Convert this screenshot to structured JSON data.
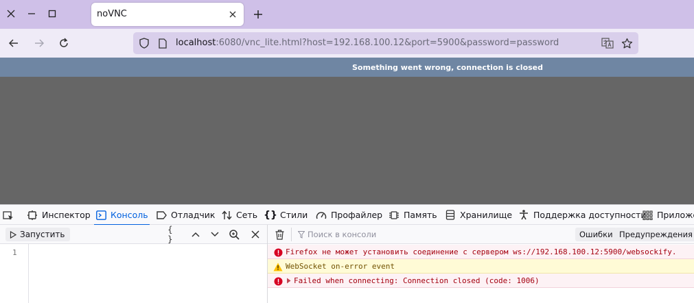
{
  "tab": {
    "title": "noVNC"
  },
  "url": {
    "host": "localhost",
    "rest": ":6080/vnc_lite.html?host=192.168.100.12&port=5900&password=password"
  },
  "vnc": {
    "status": "Something went wrong, connection is closed"
  },
  "devtools": {
    "tabs": [
      {
        "label": "Инспектор",
        "icon": "inspector-icon"
      },
      {
        "label": "Консоль",
        "icon": "console-icon"
      },
      {
        "label": "Отладчик",
        "icon": "debugger-icon"
      },
      {
        "label": "Сеть",
        "icon": "network-icon"
      },
      {
        "label": "Стили",
        "icon": "styles-icon"
      },
      {
        "label": "Профайлер",
        "icon": "profiler-icon"
      },
      {
        "label": "Память",
        "icon": "memory-icon"
      },
      {
        "label": "Хранилище",
        "icon": "storage-icon"
      },
      {
        "label": "Поддержка доступности",
        "icon": "accessibility-icon"
      },
      {
        "label": "Приложе",
        "icon": "application-icon"
      }
    ],
    "active_tab": "Консоль",
    "editor": {
      "run_label": "Запустить",
      "pretty_label": "{ }",
      "line_number": "1"
    },
    "console": {
      "filter_placeholder": "Поиск в консоли",
      "filter_buttons": [
        "Ошибки",
        "Предупреждения"
      ],
      "messages": [
        {
          "level": "error",
          "text": "Firefox не может установить соединение с сервером ws://192.168.100.12:5900/websockify."
        },
        {
          "level": "warning",
          "text": "WebSocket on-error event"
        },
        {
          "level": "error",
          "text": "Failed when connecting: Connection closed (code: 1006)"
        }
      ]
    }
  },
  "colors": {
    "accent": "#0060df",
    "error": "#a4000f",
    "warning": "#715100",
    "titlebar": "#cfc0e8"
  }
}
